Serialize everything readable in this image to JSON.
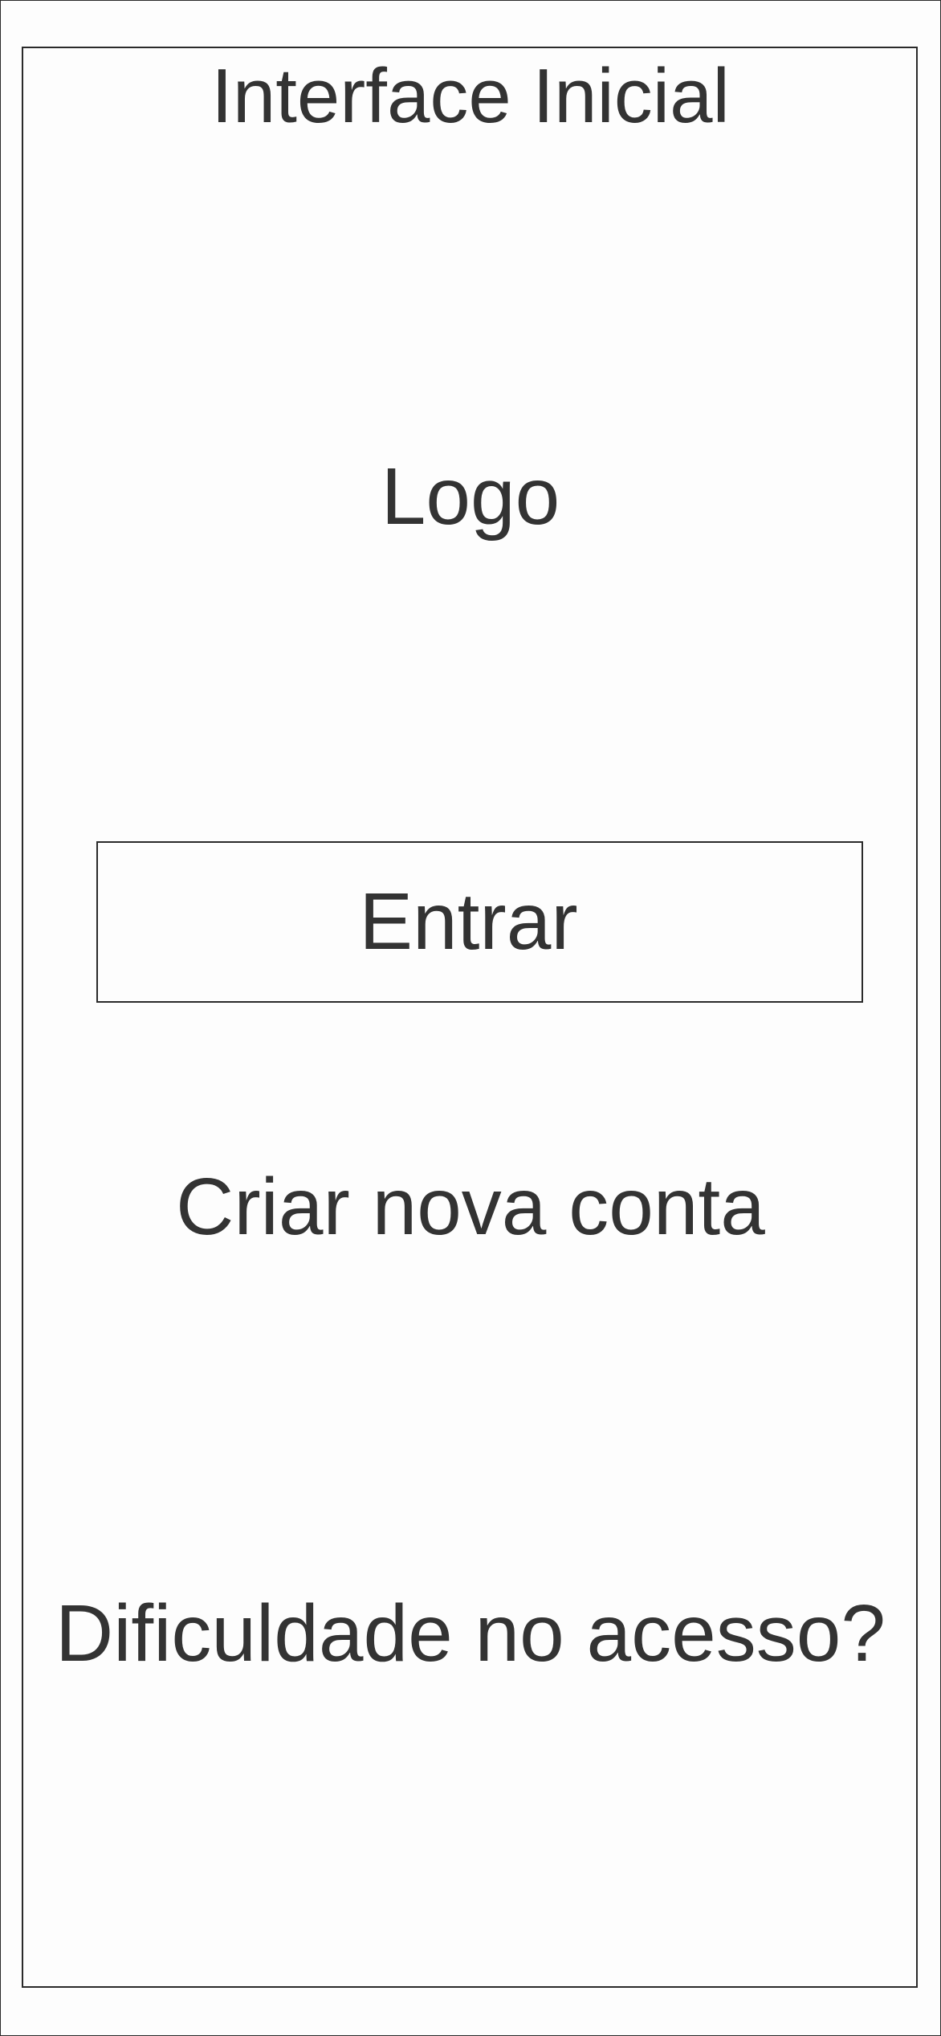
{
  "screen": {
    "title": "Interface Inicial",
    "logo_placeholder": "Logo",
    "login_button_label": "Entrar",
    "create_account_link": "Criar nova conta",
    "access_help_link": "Dificuldade no acesso?"
  }
}
